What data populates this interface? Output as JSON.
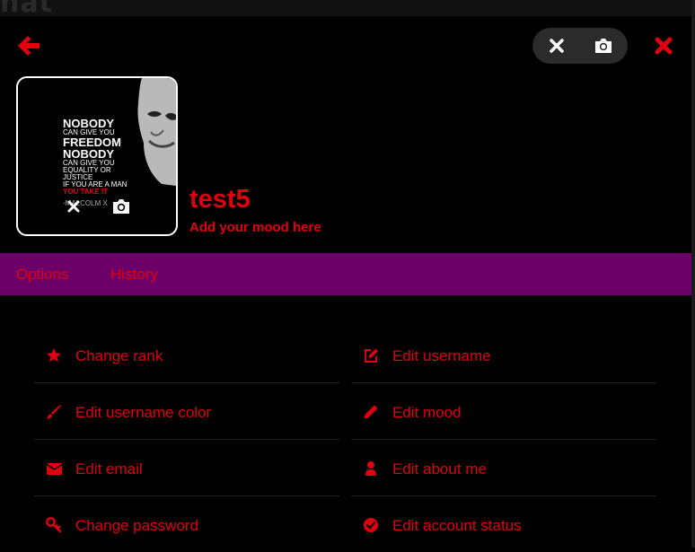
{
  "header": {
    "strip_text": "hat"
  },
  "profile": {
    "username": "test5",
    "mood_placeholder": "Add your mood here",
    "poster_lines": [
      "NOBODY",
      "CAN GIVE YOU",
      "FREEDOM",
      "NOBODY",
      "CAN GIVE YOU",
      "EQUALITY OR JUSTICE",
      "IF YOU ARE A MAN",
      "YOU TAKE IT"
    ],
    "poster_signature": "-MALCOLM X"
  },
  "tabs": [
    {
      "label": "Options"
    },
    {
      "label": "History"
    }
  ],
  "options": {
    "left": [
      {
        "label": "Change rank",
        "icon": "star-icon"
      },
      {
        "label": "Edit username color",
        "icon": "brush-icon"
      },
      {
        "label": "Edit email",
        "icon": "envelope-icon"
      },
      {
        "label": "Change password",
        "icon": "key-icon"
      }
    ],
    "right": [
      {
        "label": "Edit username",
        "icon": "edit-icon"
      },
      {
        "label": "Edit mood",
        "icon": "pencil-icon"
      },
      {
        "label": "Edit about me",
        "icon": "user-icon"
      },
      {
        "label": "Edit account status",
        "icon": "check-circle-icon"
      }
    ]
  },
  "colors": {
    "accent": "#e0000e",
    "tab_bar": "#6c0069",
    "background": "#000000"
  }
}
